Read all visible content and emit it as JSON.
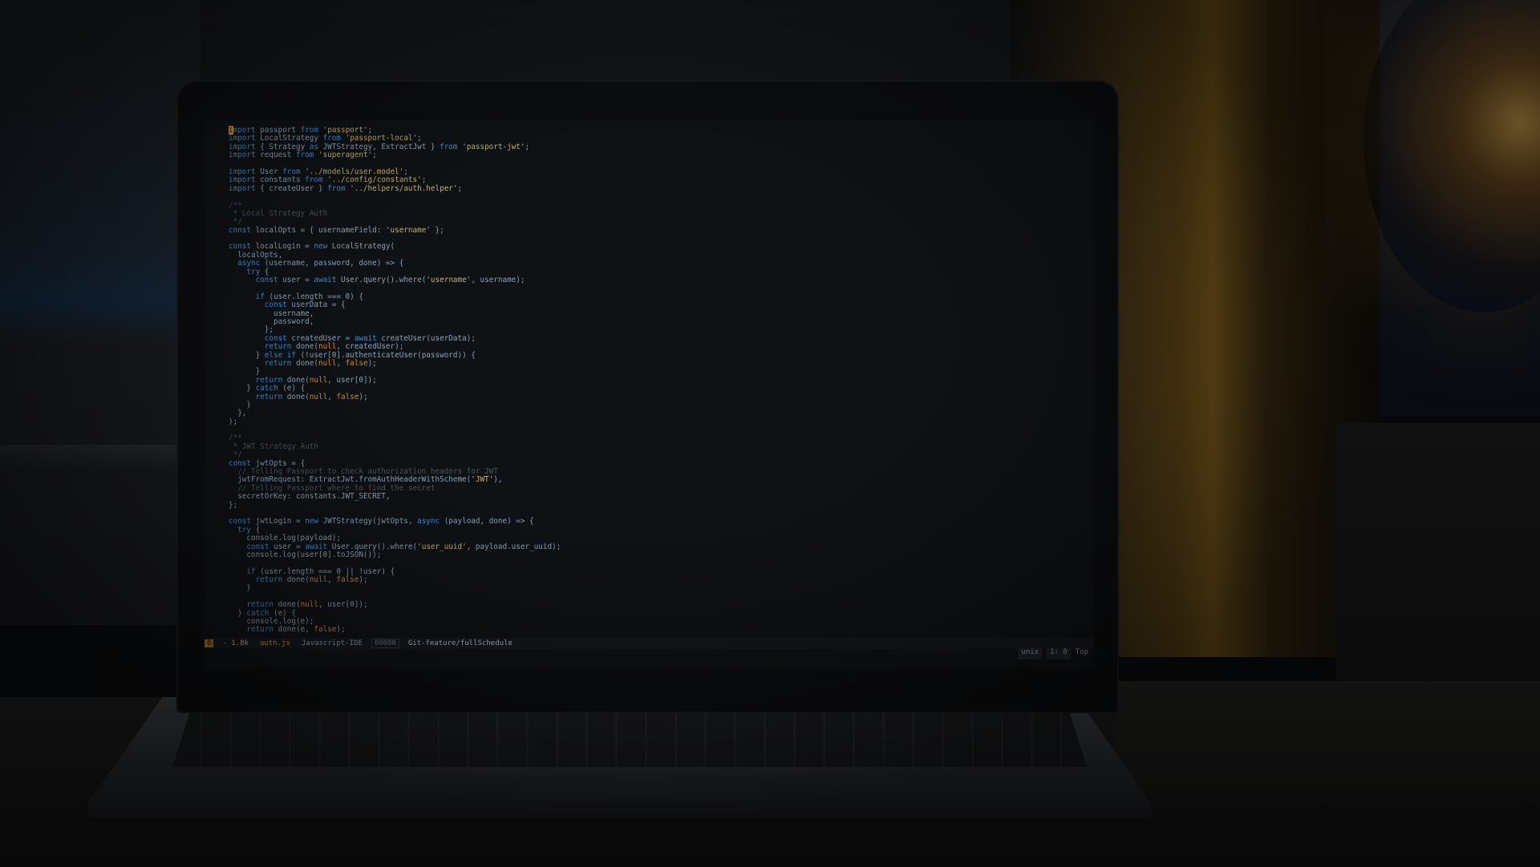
{
  "code_lines": [
    "import passport from 'passport';",
    "import LocalStrategy from 'passport-local';",
    "import { Strategy as JWTStrategy, ExtractJwt } from 'passport-jwt';",
    "import request from 'superagent';",
    "",
    "import User from '../models/user.model';",
    "import constants from '../config/constants';",
    "import { createUser } from '../helpers/auth.helper';",
    "",
    "/**",
    " * Local Strategy Auth",
    " */",
    "const localOpts = { usernameField: 'username' };",
    "",
    "const localLogin = new LocalStrategy(",
    "  localOpts,",
    "  async (username, password, done) => {",
    "    try {",
    "      const user = await User.query().where('username', username);",
    "",
    "      if (user.length === 0) {",
    "        const userData = {",
    "          username,",
    "          password,",
    "        };",
    "        const createdUser = await createUser(userData);",
    "        return done(null, createdUser);",
    "      } else if (!user[0].authenticateUser(password)) {",
    "        return done(null, false);",
    "      }",
    "      return done(null, user[0]);",
    "    } catch (e) {",
    "      return done(null, false);",
    "    }",
    "  },",
    ");",
    "",
    "/**",
    " * JWT Strategy Auth",
    " */",
    "const jwtOpts = {",
    "  // Telling Passport to check authorization headers for JWT",
    "  jwtFromRequest: ExtractJwt.fromAuthHeaderWithScheme('JWT'),",
    "  // Telling Passport where to find the secret",
    "  secretOrKey: constants.JWT_SECRET,",
    "};",
    "",
    "const jwtLogin = new JWTStrategy(jwtOpts, async (payload, done) => {",
    "  try {",
    "    console.log(payload);",
    "    const user = await User.query().where('user_uuid', payload.user_uuid);",
    "    console.log(user[0].toJSON());",
    "",
    "    if (user.length === 0 || !user) {",
    "      return done(null, false);",
    "    }",
    "",
    "    return done(null, user[0]);",
    "  } catch (e) {",
    "    console.log(e);",
    "    return done(e, false);"
  ],
  "status_bar": {
    "mode": "0",
    "size": "- 1.8k",
    "filename": "auth.js",
    "filetype": "Javascript-IDE",
    "progress": "00000",
    "branch": "Git-feature/fullSchedule",
    "encoding": "unix",
    "position": "1: 0",
    "scroll": "Top"
  },
  "colors": {
    "keyword": "#3d8fd6",
    "string": "#c7b36a",
    "param": "#d68a2b",
    "comment": "#4a5560",
    "lamp_glow": "#d29a3a"
  }
}
